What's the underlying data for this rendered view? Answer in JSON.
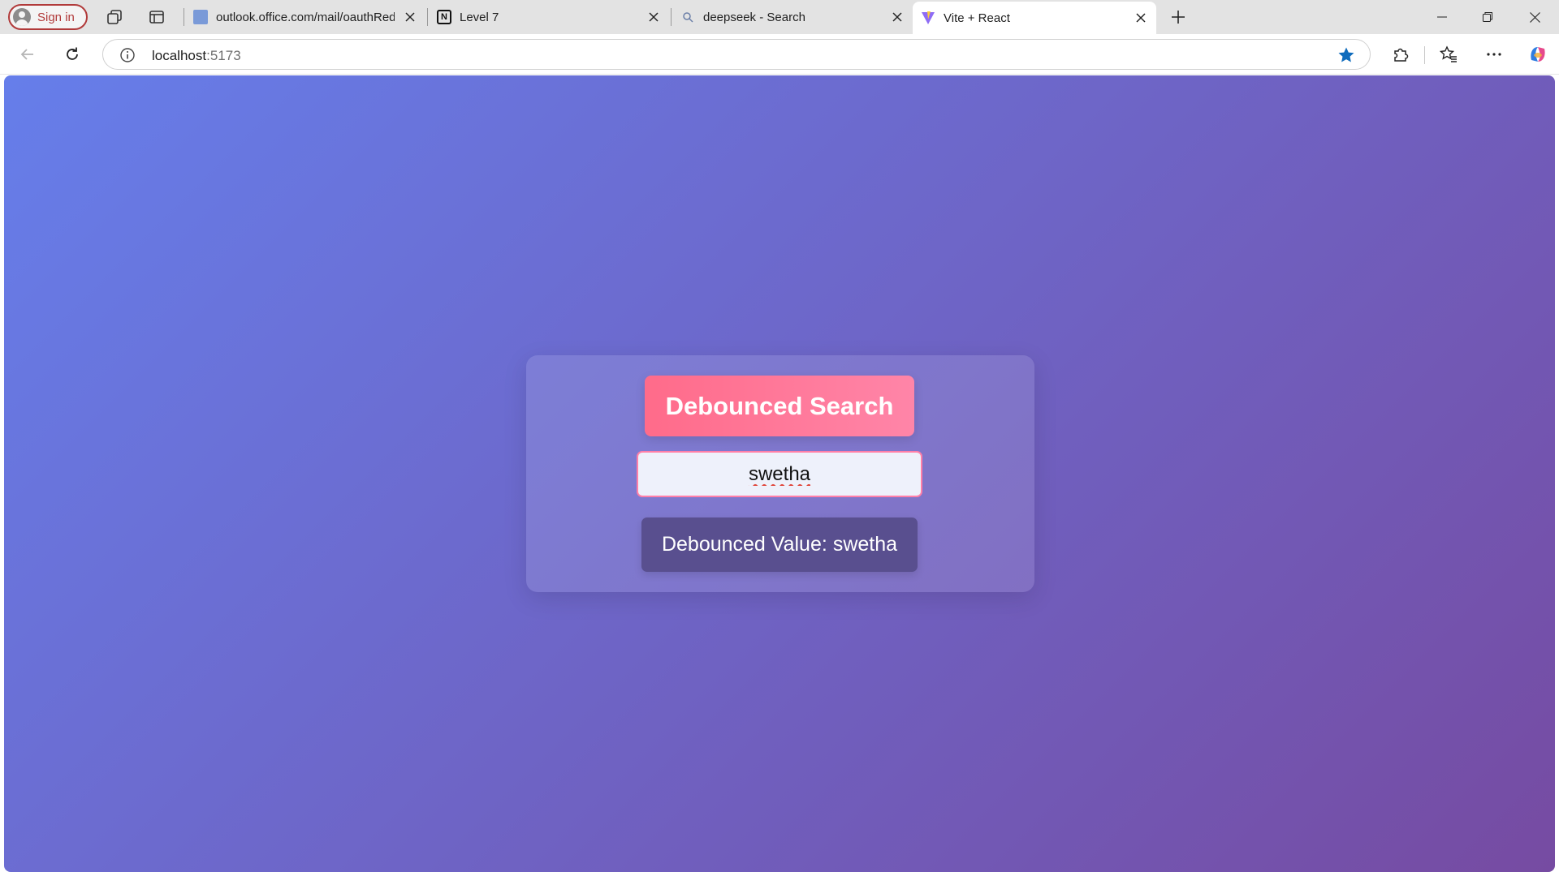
{
  "browser": {
    "signin_label": "Sign in",
    "tabs": [
      {
        "title": "outlook.office.com/mail/oauthRed",
        "favicon": "outlook-icon"
      },
      {
        "title": "Level 7",
        "favicon": "notion-icon"
      },
      {
        "title": "deepseek - Search",
        "favicon": "search-icon"
      },
      {
        "title": "Vite + React",
        "favicon": "vite-icon",
        "active": true
      }
    ],
    "url_host": "localhost",
    "url_port": ":5173",
    "accent_color": "#0f6cbd"
  },
  "page": {
    "title": "Debounced Search",
    "search": {
      "value": "swetha",
      "placeholder": ""
    },
    "result_label": "Debounced Value:",
    "result_value": "swetha",
    "colors": {
      "gradient_start": "#667eea",
      "gradient_end": "#764ba2",
      "title_bg": "#ff6b8a",
      "result_bg": "#594f8f"
    }
  }
}
